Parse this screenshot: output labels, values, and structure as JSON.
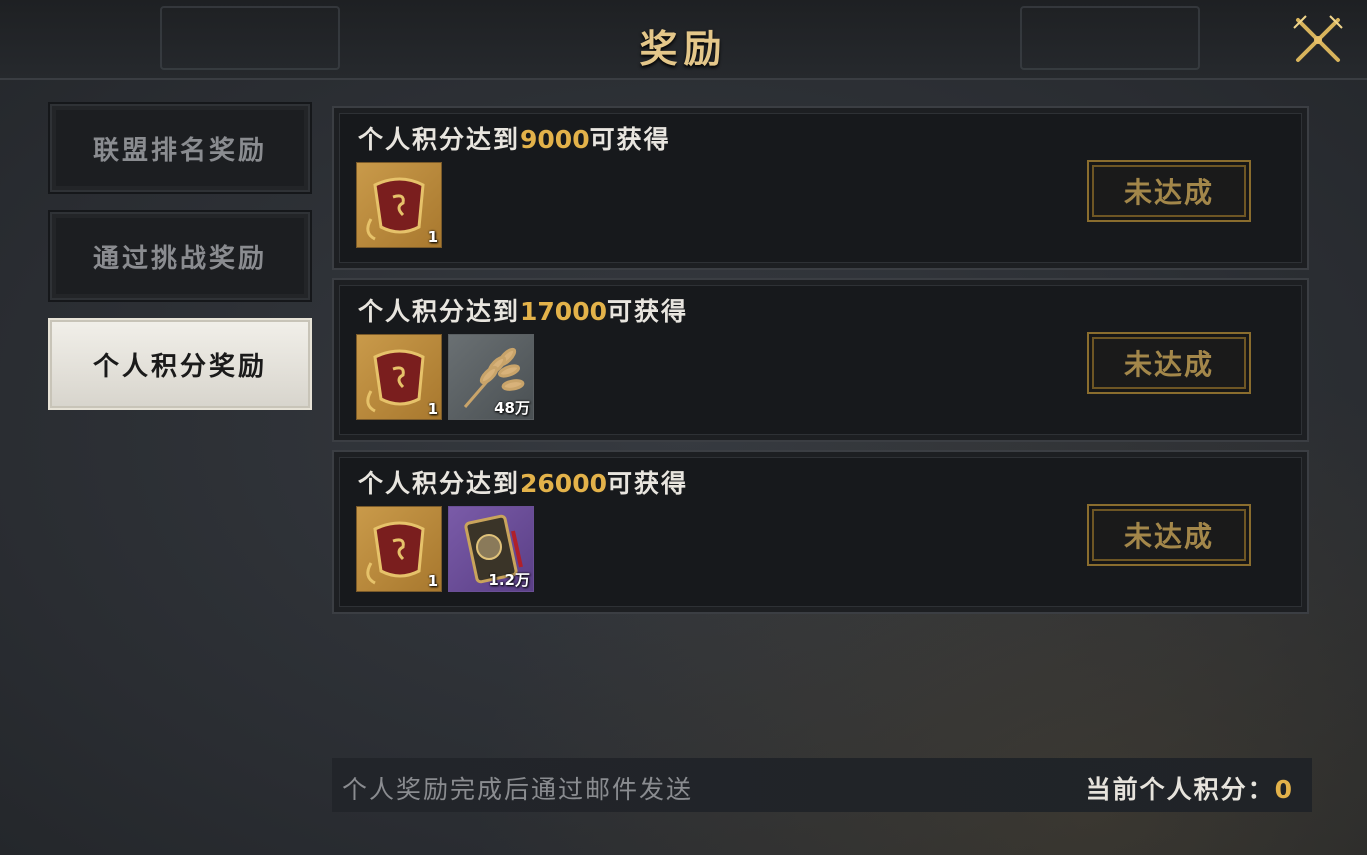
{
  "window": {
    "title": "奖励"
  },
  "tabs": [
    {
      "label": "联盟排名奖励",
      "active": false
    },
    {
      "label": "通过挑战奖励",
      "active": false
    },
    {
      "label": "个人积分奖励",
      "active": true
    }
  ],
  "rewards": [
    {
      "prefix": "个人积分达到",
      "points": "9000",
      "suffix": "可获得",
      "status": "未达成",
      "items": [
        {
          "icon": "dragon-token-icon",
          "qty": "1"
        }
      ]
    },
    {
      "prefix": "个人积分达到",
      "points": "17000",
      "suffix": "可获得",
      "status": "未达成",
      "items": [
        {
          "icon": "dragon-token-icon",
          "qty": "1"
        },
        {
          "icon": "wheat-grain-icon",
          "qty": "48万"
        }
      ]
    },
    {
      "prefix": "个人积分达到",
      "points": "26000",
      "suffix": "可获得",
      "status": "未达成",
      "items": [
        {
          "icon": "dragon-token-icon",
          "qty": "1"
        },
        {
          "icon": "battle-order-icon",
          "qty": "1.2万"
        }
      ]
    }
  ],
  "footer": {
    "note": "个人奖励完成后通过邮件发送",
    "score_label": "当前个人积分：",
    "score_value": "0"
  },
  "colors": {
    "accent_gold": "#e3b24a",
    "title_gold": "#e4c78a",
    "status_text": "#a3874a"
  }
}
